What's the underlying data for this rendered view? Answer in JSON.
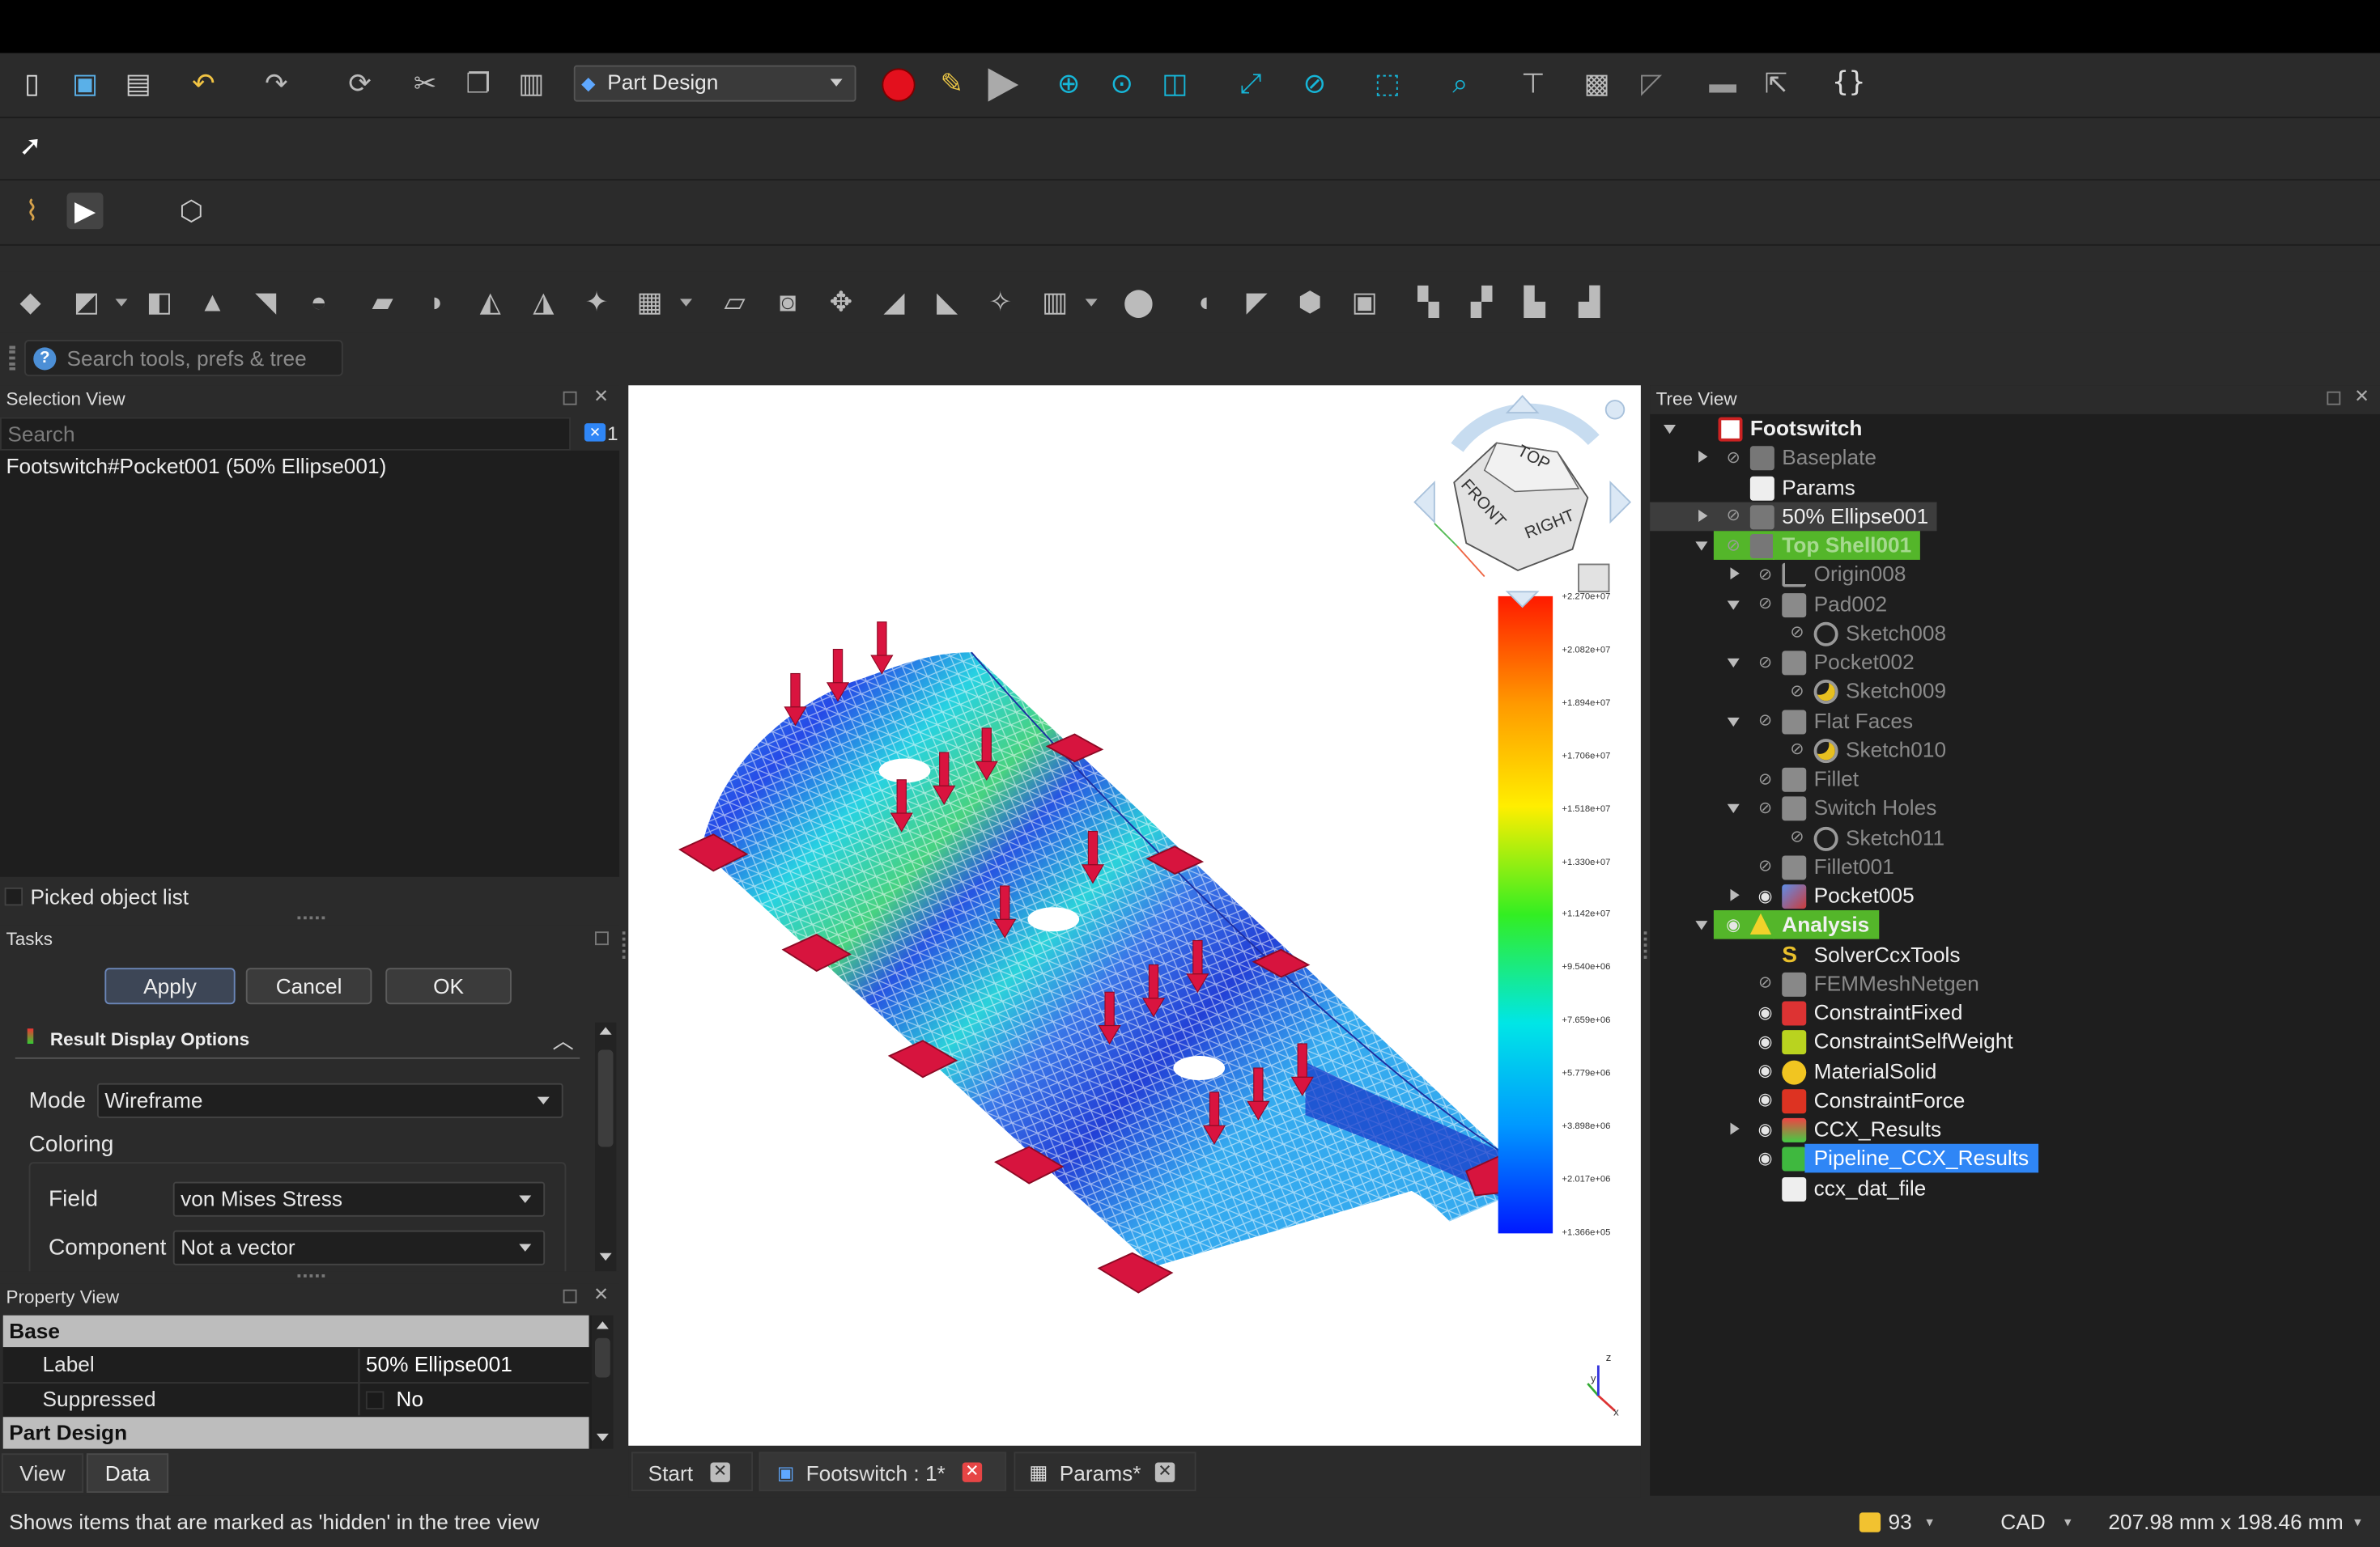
{
  "toolbar": {
    "workbench": "Part Design",
    "search_placeholder": "Search tools, prefs & tree"
  },
  "selection_view": {
    "title": "Selection View",
    "search_placeholder": "Search",
    "count": "1",
    "items": [
      "Footswitch#Pocket001 (50% Ellipse001)"
    ],
    "picked_object_list": "Picked object list"
  },
  "tasks": {
    "title": "Tasks",
    "apply": "Apply",
    "cancel": "Cancel",
    "ok": "OK",
    "result_display_title": "Result Display Options",
    "mode_label": "Mode",
    "mode_value": "Wireframe",
    "coloring_label": "Coloring",
    "field_label": "Field",
    "field_value": "von Mises Stress",
    "component_label": "Component",
    "component_value": "Not a vector"
  },
  "property_view": {
    "title": "Property View",
    "group_base": "Base",
    "label_key": "Label",
    "label_value": "50% Ellipse001",
    "suppressed_key": "Suppressed",
    "suppressed_value": "No",
    "group_part_design": "Part Design",
    "tab_view": "View",
    "tab_data": "Data"
  },
  "viewport": {
    "navcube": {
      "top": "TOP",
      "front": "FRONT",
      "right": "RIGHT"
    },
    "color_scale": [
      "+2.270e+07",
      "+2.082e+07",
      "+1.894e+07",
      "+1.706e+07",
      "+1.518e+07",
      "+1.330e+07",
      "+1.142e+07",
      "+9.540e+06",
      "+7.659e+06",
      "+5.779e+06",
      "+3.898e+06",
      "+2.017e+06",
      "+1.366e+05"
    ],
    "axis": {
      "x": "x",
      "y": "y",
      "z": "z"
    }
  },
  "doc_tabs": [
    {
      "label": "Start"
    },
    {
      "label": "Footswitch : 1*"
    },
    {
      "label": "Params*"
    }
  ],
  "tree_view": {
    "title": "Tree View",
    "items": [
      {
        "label": "Footswitch"
      },
      {
        "label": "Baseplate"
      },
      {
        "label": "Params"
      },
      {
        "label": "50% Ellipse001"
      },
      {
        "label": "Top Shell001"
      },
      {
        "label": "Origin008"
      },
      {
        "label": "Pad002"
      },
      {
        "label": "Sketch008"
      },
      {
        "label": "Pocket002"
      },
      {
        "label": "Sketch009"
      },
      {
        "label": "Flat Faces"
      },
      {
        "label": "Sketch010"
      },
      {
        "label": "Fillet"
      },
      {
        "label": "Switch Holes"
      },
      {
        "label": "Sketch011"
      },
      {
        "label": "Fillet001"
      },
      {
        "label": "Pocket005"
      },
      {
        "label": "Analysis"
      },
      {
        "label": "SolverCcxTools"
      },
      {
        "label": "FEMMeshNetgen"
      },
      {
        "label": "ConstraintFixed"
      },
      {
        "label": "ConstraintSelfWeight"
      },
      {
        "label": "MaterialSolid"
      },
      {
        "label": "ConstraintForce"
      },
      {
        "label": "CCX_Results"
      },
      {
        "label": "Pipeline_CCX_Results"
      },
      {
        "label": "ccx_dat_file"
      }
    ]
  },
  "status_bar": {
    "message": "Shows items that are marked as 'hidden' in the tree view",
    "notifications": "93",
    "nav_style": "CAD",
    "dimensions": "207.98 mm x 198.46 mm"
  },
  "colors": {
    "accent_selected": "#2f86f6",
    "highlight_green": "#54b62a",
    "force_arrow": "#d9143f",
    "background": "#2b2b2b"
  }
}
